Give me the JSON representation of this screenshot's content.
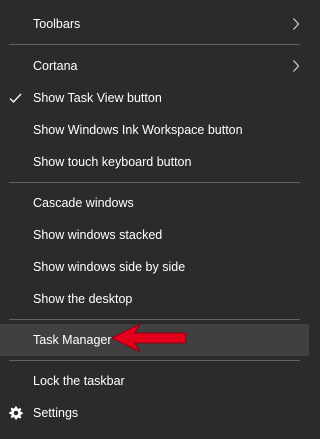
{
  "menu": {
    "toolbars": "Toolbars",
    "cortana": "Cortana",
    "show_task_view": "Show Task View button",
    "show_ink_workspace": "Show Windows Ink Workspace button",
    "show_touch_keyboard": "Show touch keyboard button",
    "cascade": "Cascade windows",
    "stacked": "Show windows stacked",
    "side_by_side": "Show windows side by side",
    "show_desktop": "Show the desktop",
    "task_manager": "Task Manager",
    "lock_taskbar": "Lock the taskbar",
    "settings": "Settings"
  },
  "state": {
    "task_view_checked": true,
    "highlighted_item": "Task Manager"
  },
  "icons": {
    "submenu": "chevron-right-icon",
    "checked": "checkmark-icon",
    "settings": "gear-icon",
    "annotation": "red-arrow-icon"
  },
  "colors": {
    "background": "#2b2b2b",
    "highlight": "#404040",
    "separator": "#636363",
    "text": "#ffffff",
    "annotation_arrow": "#e3001b"
  }
}
